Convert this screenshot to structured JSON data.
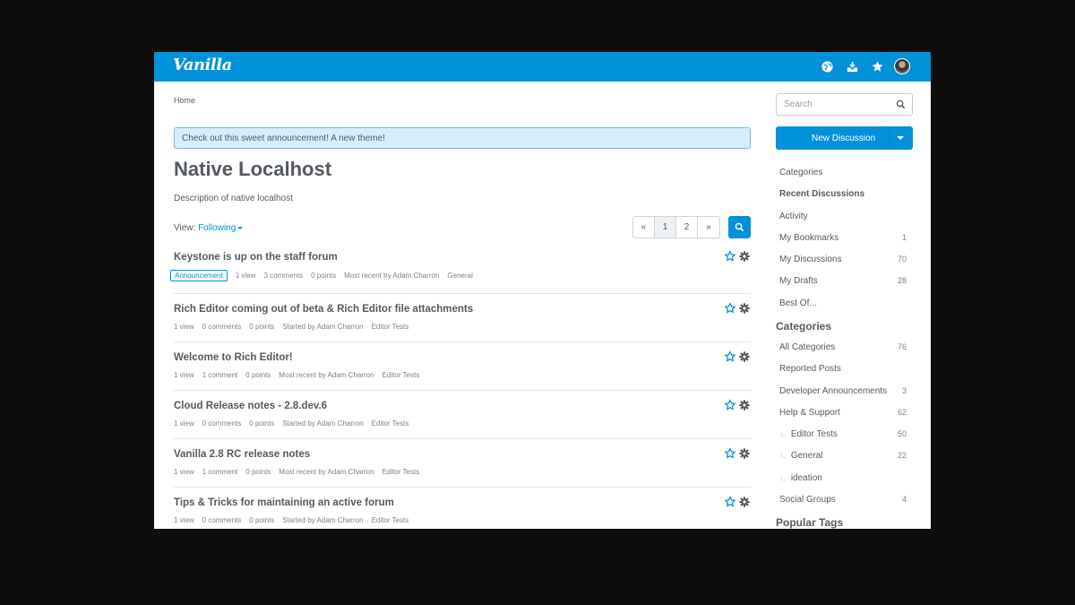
{
  "header": {
    "logo": "Vanilla",
    "icons": [
      "globe-icon",
      "inbox-icon",
      "star-icon",
      "avatar"
    ],
    "accent": "#0291db"
  },
  "breadcrumb": "Home",
  "announcement": "Check out this sweet announcement! A new theme!",
  "page": {
    "title": "Native Localhost",
    "description": "Description of native localhost",
    "view_label": "View:",
    "view_value": "Following"
  },
  "pager": {
    "prev": "«",
    "pages": [
      "1",
      "2"
    ],
    "next": "»",
    "current": "1"
  },
  "discussions": [
    {
      "title": "Keystone is up on the staff forum",
      "badge": "Announcement",
      "views": "1 view",
      "comments": "3 comments",
      "points": "0 points",
      "by": "Most recent by Adam Charron",
      "category": "General"
    },
    {
      "title": "Rich Editor coming out of beta & Rich Editor file attachments",
      "badge": "",
      "views": "1 view",
      "comments": "0 comments",
      "points": "0 points",
      "by": "Started by Adam Charron",
      "category": "Editor Tests"
    },
    {
      "title": "Welcome to Rich Editor!",
      "badge": "",
      "views": "1 view",
      "comments": "1 comment",
      "points": "0 points",
      "by": "Most recent by Adam Charron",
      "category": "Editor Tests"
    },
    {
      "title": "Cloud Release notes - 2.8.dev.6",
      "badge": "",
      "views": "1 view",
      "comments": "0 comments",
      "points": "0 points",
      "by": "Started by Adam Charron",
      "category": "Editor Tests"
    },
    {
      "title": "Vanilla 2.8 RC release notes",
      "badge": "",
      "views": "1 view",
      "comments": "1 comment",
      "points": "0 points",
      "by": "Most recent by Adam Charron",
      "category": "Editor Tests"
    },
    {
      "title": "Tips & Tricks for maintaining an active forum",
      "badge": "",
      "views": "1 view",
      "comments": "0 comments",
      "points": "0 points",
      "by": "Started by Adam Charron",
      "category": "Editor Tests"
    }
  ],
  "sidebar": {
    "search_placeholder": "Search",
    "new_discussion": "New Discussion",
    "nav": [
      {
        "label": "Categories",
        "count": ""
      },
      {
        "label": "Recent Discussions",
        "count": ""
      },
      {
        "label": "Activity",
        "count": ""
      },
      {
        "label": "My Bookmarks",
        "count": "1"
      },
      {
        "label": "My Discussions",
        "count": "70"
      },
      {
        "label": "My Drafts",
        "count": "28"
      },
      {
        "label": "Best Of...",
        "count": ""
      }
    ],
    "categories_heading": "Categories",
    "categories": [
      {
        "label": "All Categories",
        "count": "76"
      },
      {
        "label": "Reported Posts",
        "count": ""
      },
      {
        "label": "Developer Announcements",
        "count": "3"
      },
      {
        "label": "Help & Support",
        "count": "62"
      },
      {
        "label": "Editor Tests",
        "count": "50"
      },
      {
        "label": "General",
        "count": "22"
      },
      {
        "label": "ideation",
        "count": ""
      },
      {
        "label": "Social Groups",
        "count": "4"
      }
    ],
    "sub_marker": "∟",
    "tags_heading": "Popular Tags"
  }
}
